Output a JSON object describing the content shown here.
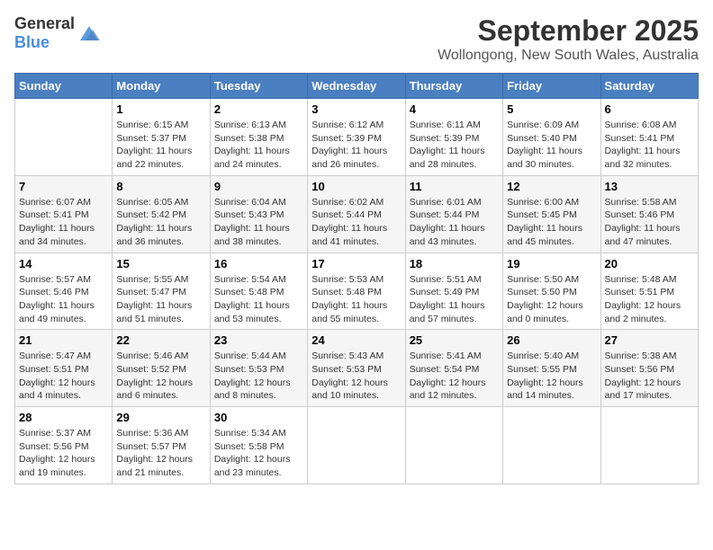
{
  "logo": {
    "text_general": "General",
    "text_blue": "Blue"
  },
  "title": "September 2025",
  "location": "Wollongong, New South Wales, Australia",
  "headers": [
    "Sunday",
    "Monday",
    "Tuesday",
    "Wednesday",
    "Thursday",
    "Friday",
    "Saturday"
  ],
  "weeks": [
    [
      {
        "day": "",
        "content": ""
      },
      {
        "day": "1",
        "content": "Sunrise: 6:15 AM\nSunset: 5:37 PM\nDaylight: 11 hours\nand 22 minutes."
      },
      {
        "day": "2",
        "content": "Sunrise: 6:13 AM\nSunset: 5:38 PM\nDaylight: 11 hours\nand 24 minutes."
      },
      {
        "day": "3",
        "content": "Sunrise: 6:12 AM\nSunset: 5:39 PM\nDaylight: 11 hours\nand 26 minutes."
      },
      {
        "day": "4",
        "content": "Sunrise: 6:11 AM\nSunset: 5:39 PM\nDaylight: 11 hours\nand 28 minutes."
      },
      {
        "day": "5",
        "content": "Sunrise: 6:09 AM\nSunset: 5:40 PM\nDaylight: 11 hours\nand 30 minutes."
      },
      {
        "day": "6",
        "content": "Sunrise: 6:08 AM\nSunset: 5:41 PM\nDaylight: 11 hours\nand 32 minutes."
      }
    ],
    [
      {
        "day": "7",
        "content": "Sunrise: 6:07 AM\nSunset: 5:41 PM\nDaylight: 11 hours\nand 34 minutes."
      },
      {
        "day": "8",
        "content": "Sunrise: 6:05 AM\nSunset: 5:42 PM\nDaylight: 11 hours\nand 36 minutes."
      },
      {
        "day": "9",
        "content": "Sunrise: 6:04 AM\nSunset: 5:43 PM\nDaylight: 11 hours\nand 38 minutes."
      },
      {
        "day": "10",
        "content": "Sunrise: 6:02 AM\nSunset: 5:44 PM\nDaylight: 11 hours\nand 41 minutes."
      },
      {
        "day": "11",
        "content": "Sunrise: 6:01 AM\nSunset: 5:44 PM\nDaylight: 11 hours\nand 43 minutes."
      },
      {
        "day": "12",
        "content": "Sunrise: 6:00 AM\nSunset: 5:45 PM\nDaylight: 11 hours\nand 45 minutes."
      },
      {
        "day": "13",
        "content": "Sunrise: 5:58 AM\nSunset: 5:46 PM\nDaylight: 11 hours\nand 47 minutes."
      }
    ],
    [
      {
        "day": "14",
        "content": "Sunrise: 5:57 AM\nSunset: 5:46 PM\nDaylight: 11 hours\nand 49 minutes."
      },
      {
        "day": "15",
        "content": "Sunrise: 5:55 AM\nSunset: 5:47 PM\nDaylight: 11 hours\nand 51 minutes."
      },
      {
        "day": "16",
        "content": "Sunrise: 5:54 AM\nSunset: 5:48 PM\nDaylight: 11 hours\nand 53 minutes."
      },
      {
        "day": "17",
        "content": "Sunrise: 5:53 AM\nSunset: 5:48 PM\nDaylight: 11 hours\nand 55 minutes."
      },
      {
        "day": "18",
        "content": "Sunrise: 5:51 AM\nSunset: 5:49 PM\nDaylight: 11 hours\nand 57 minutes."
      },
      {
        "day": "19",
        "content": "Sunrise: 5:50 AM\nSunset: 5:50 PM\nDaylight: 12 hours\nand 0 minutes."
      },
      {
        "day": "20",
        "content": "Sunrise: 5:48 AM\nSunset: 5:51 PM\nDaylight: 12 hours\nand 2 minutes."
      }
    ],
    [
      {
        "day": "21",
        "content": "Sunrise: 5:47 AM\nSunset: 5:51 PM\nDaylight: 12 hours\nand 4 minutes."
      },
      {
        "day": "22",
        "content": "Sunrise: 5:46 AM\nSunset: 5:52 PM\nDaylight: 12 hours\nand 6 minutes."
      },
      {
        "day": "23",
        "content": "Sunrise: 5:44 AM\nSunset: 5:53 PM\nDaylight: 12 hours\nand 8 minutes."
      },
      {
        "day": "24",
        "content": "Sunrise: 5:43 AM\nSunset: 5:53 PM\nDaylight: 12 hours\nand 10 minutes."
      },
      {
        "day": "25",
        "content": "Sunrise: 5:41 AM\nSunset: 5:54 PM\nDaylight: 12 hours\nand 12 minutes."
      },
      {
        "day": "26",
        "content": "Sunrise: 5:40 AM\nSunset: 5:55 PM\nDaylight: 12 hours\nand 14 minutes."
      },
      {
        "day": "27",
        "content": "Sunrise: 5:38 AM\nSunset: 5:56 PM\nDaylight: 12 hours\nand 17 minutes."
      }
    ],
    [
      {
        "day": "28",
        "content": "Sunrise: 5:37 AM\nSunset: 5:56 PM\nDaylight: 12 hours\nand 19 minutes."
      },
      {
        "day": "29",
        "content": "Sunrise: 5:36 AM\nSunset: 5:57 PM\nDaylight: 12 hours\nand 21 minutes."
      },
      {
        "day": "30",
        "content": "Sunrise: 5:34 AM\nSunset: 5:58 PM\nDaylight: 12 hours\nand 23 minutes."
      },
      {
        "day": "",
        "content": ""
      },
      {
        "day": "",
        "content": ""
      },
      {
        "day": "",
        "content": ""
      },
      {
        "day": "",
        "content": ""
      }
    ]
  ]
}
